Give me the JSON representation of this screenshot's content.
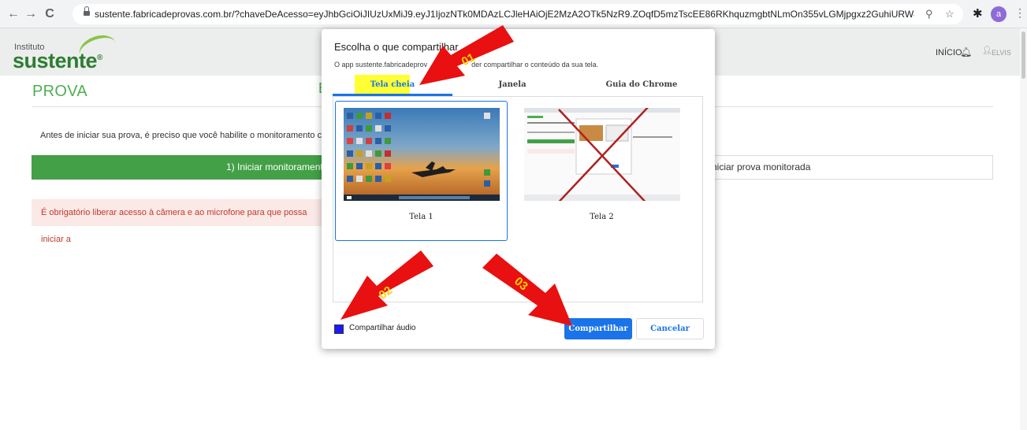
{
  "browser": {
    "url": "sustente.fabricadeprovas.com.br/?chaveDeAcesso=eyJhbGciOiJIUzUxMiJ9.eyJ1IjozNTk0MDAzLCJleHAiOjE2MzA2OTk5NzR9.ZOqfD5mzTscEE86RKhquzmgbtNLmOn355vLGMjpgxz2GuhiURW8WSkTUF7AEZv2...",
    "profile_initial": "a",
    "icons": [
      "back-arrow",
      "forward-arrow",
      "reload",
      "lock",
      "zoom",
      "bookmark-star",
      "extensions-puzzle",
      "more-menu"
    ]
  },
  "header": {
    "logo_small": "Instituto",
    "logo_main": "sustente",
    "logo_mark": "®",
    "nav_home": "INÍCIO",
    "user_name": "ELVIS"
  },
  "page": {
    "title": "PROVA",
    "heading_partial": "E",
    "intro": "Antes de iniciar sua prova, é preciso que você habilite o monitoramento clicando no b",
    "btn_monitor": "1) Iniciar monitoramento",
    "btn_start": "niciar prova monitorada",
    "warning": "É obrigatório liberar acesso à câmera e ao microfone para que possa iniciar a"
  },
  "dialog": {
    "title": "Escolha o que compartilhar",
    "subtitle_start": "O app sustente.fabricadeprov",
    "subtitle_end": "der compartilhar o conteúdo da sua tela.",
    "tabs": [
      {
        "label": "Tela cheia",
        "active": true
      },
      {
        "label": "Janela",
        "active": false
      },
      {
        "label": "Guia do Chrome",
        "active": false
      }
    ],
    "screens": [
      {
        "label": "Tela 1",
        "selected": true
      },
      {
        "label": "Tela 2",
        "selected": false
      }
    ],
    "share_audio_label": "Compartilhar áudio",
    "share_audio_checked": true,
    "btn_share": "Compartilhar",
    "btn_cancel": "Cancelar"
  },
  "annotations": {
    "arrow_1": "01",
    "arrow_2": "02",
    "arrow_3": "03",
    "arrow_color": "#e81010",
    "number_color": "#ffd400"
  },
  "colors": {
    "accent_green": "#43a047",
    "title_green": "#4caf50",
    "chrome_blue": "#1a73e8",
    "highlight_yellow": "#ffff33"
  }
}
